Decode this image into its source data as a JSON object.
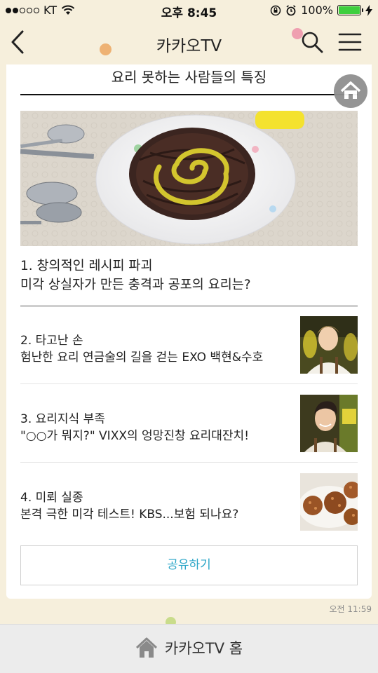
{
  "status_bar": {
    "carrier": "KT",
    "time": "오후 8:45",
    "battery": "100%",
    "battery_level": 1.0
  },
  "nav": {
    "title": "카카오TV"
  },
  "card": {
    "title": "요리 못하는 사람들의 특징",
    "lead": {
      "line1": "1. 창의적인 레시피 파괴",
      "line2": "미각 상실자가 만든 충격과 공포의 요리는?"
    },
    "items": [
      {
        "title": "2. 타고난 손",
        "subtitle": "험난한 요리 연금술의 길을 걷는 EXO 백현&수호"
      },
      {
        "title": "3. 요리지식 부족",
        "subtitle": "\"○○가 뭐지?\" VIXX의 엉망진창 요리대잔치!"
      },
      {
        "title": "4. 미뢰 실종",
        "subtitle": "본격 극한 미각 테스트! KBS...보험 되나요?"
      }
    ],
    "share_label": "공유하기"
  },
  "timestamp": "오전 11:59",
  "bottom_bar": {
    "label": "카카오TV 홈"
  },
  "icons": {
    "back": "back-arrow-icon",
    "search": "search-icon",
    "menu": "hamburger-menu-icon",
    "home": "home-icon",
    "wifi": "wifi-icon",
    "lock": "rotation-lock-icon",
    "alarm": "alarm-icon",
    "charging": "charging-bolt-icon"
  },
  "colors": {
    "background": "#f6efdc",
    "accent": "#2ba6c7",
    "battery": "#3ecf3e"
  }
}
